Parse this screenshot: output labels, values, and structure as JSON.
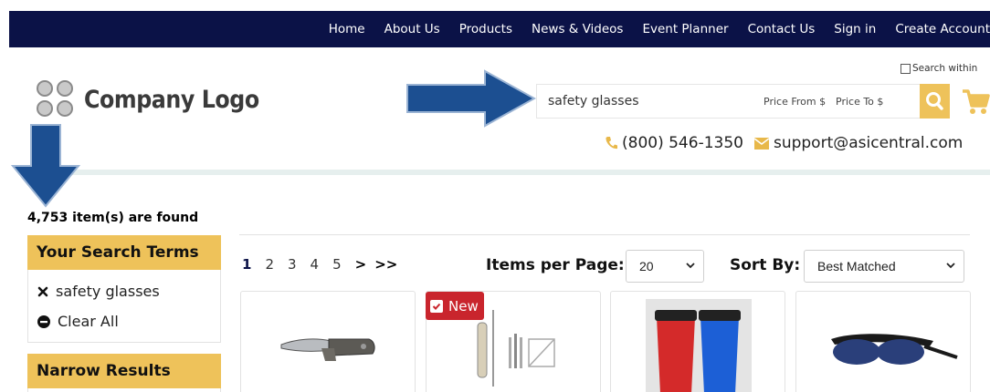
{
  "nav": {
    "items": [
      "Home",
      "About Us",
      "Products",
      "News & Videos",
      "Event Planner",
      "Contact Us",
      "Sign in",
      "Create Account"
    ]
  },
  "header": {
    "logo_text": "Company Logo",
    "search_within_label": "Search within",
    "search": {
      "value": "safety glasses",
      "price_from_label": "Price From $",
      "price_to_label": "Price To $"
    },
    "phone": "(800) 546-1350",
    "email": "support@asicentral.com"
  },
  "results": {
    "found_text": "4,753 item(s) are found",
    "pages": [
      "1",
      "2",
      "3",
      "4",
      "5"
    ],
    "next_label": ">",
    "last_label": ">>",
    "items_per_page_label": "Items per Page:",
    "items_per_page_value": "20",
    "sort_by_label": "Sort By:",
    "sort_by_value": "Best Matched",
    "new_badge": "New"
  },
  "sidebar": {
    "search_terms_title": "Your Search Terms",
    "term": "safety glasses",
    "clear_all": "Clear All",
    "narrow_title": "Narrow Results"
  },
  "colors": {
    "nav_bg": "#0b1247",
    "accent": "#eec25a",
    "arrow": "#1c4f91",
    "badge": "#c9252d"
  }
}
